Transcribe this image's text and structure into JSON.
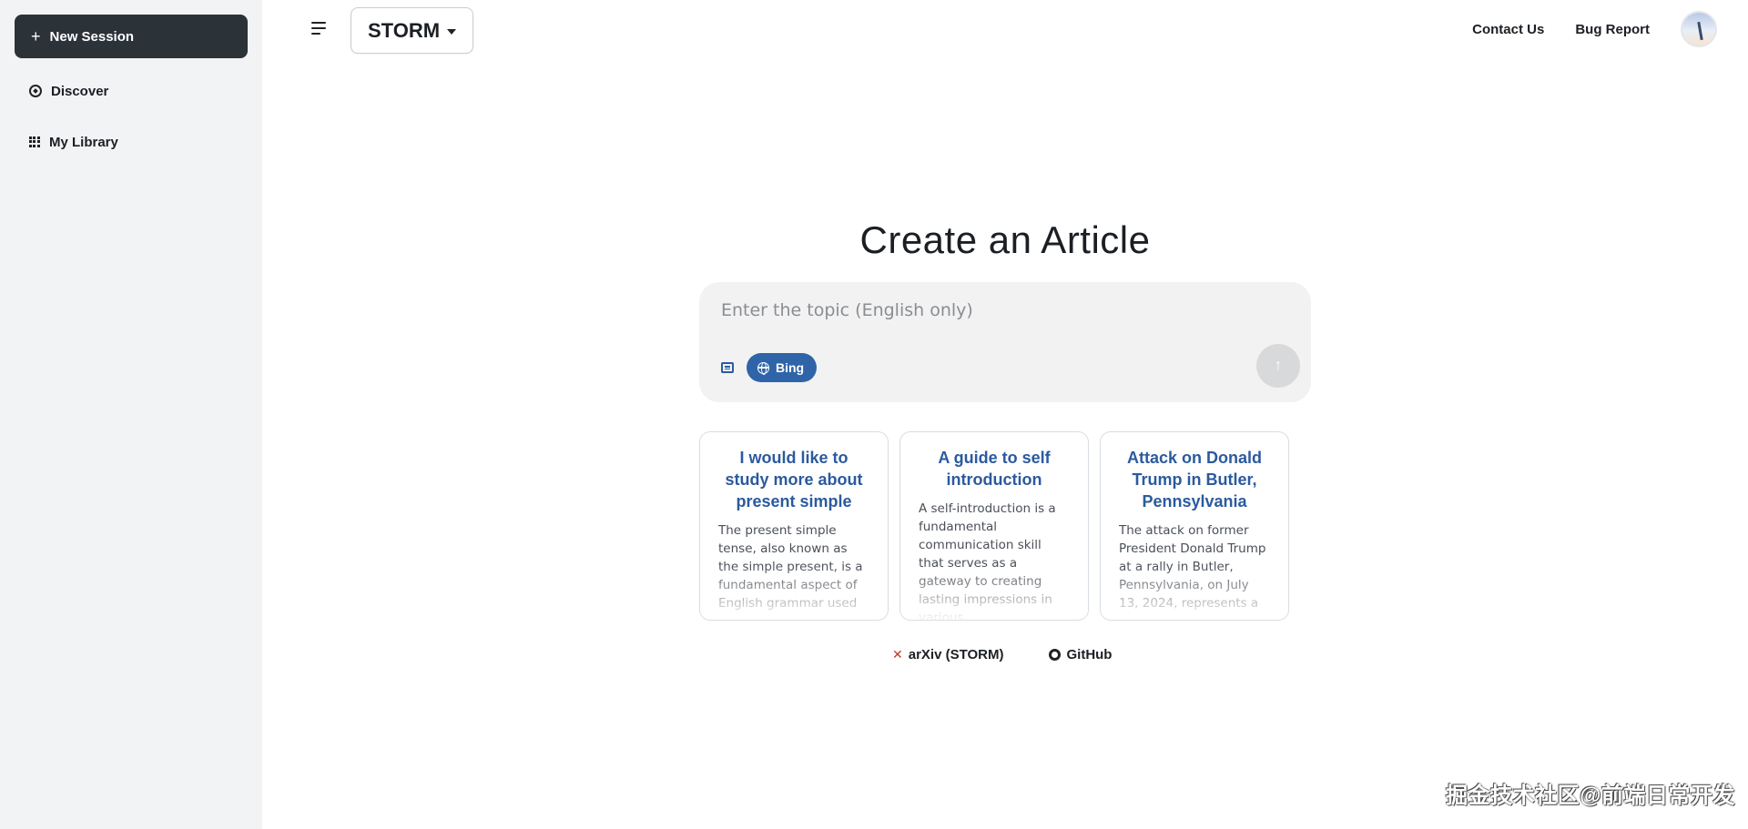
{
  "sidebar": {
    "new_session_label": "New Session",
    "items": [
      {
        "label": "Discover",
        "icon": "compass-icon"
      },
      {
        "label": "My Library",
        "icon": "grid-icon"
      }
    ]
  },
  "header": {
    "model_label": "STORM",
    "contact_label": "Contact Us",
    "bug_report_label": "Bug Report"
  },
  "main": {
    "title": "Create an Article",
    "topic_placeholder": "Enter the topic (English only)",
    "search_engine": "Bing",
    "cards": [
      {
        "title": "I would like to study more about present simple",
        "body": "The present simple tense, also known as the simple present, is a fundamental aspect of English grammar used"
      },
      {
        "title": "A guide to self introduction",
        "body": "A self-introduction is a fundamental communication skill that serves as a gateway to creating lasting impressions in various"
      },
      {
        "title": "Attack on Donald Trump in Butler, Pennsylvania",
        "body": "The attack on former President Donald Trump at a rally in Butler, Pennsylvania, on July 13, 2024, represents a"
      }
    ],
    "links": [
      {
        "label": "arXiv (STORM)",
        "icon": "x-icon"
      },
      {
        "label": "GitHub",
        "icon": "github-icon"
      }
    ]
  },
  "watermark": "掘金技术社区@前端日常开发",
  "colors": {
    "sidebar_bg": "#f2f3f5",
    "new_session_bg": "#2b3238",
    "accent_blue": "#2f64a8",
    "card_title": "#2b5a9e"
  }
}
